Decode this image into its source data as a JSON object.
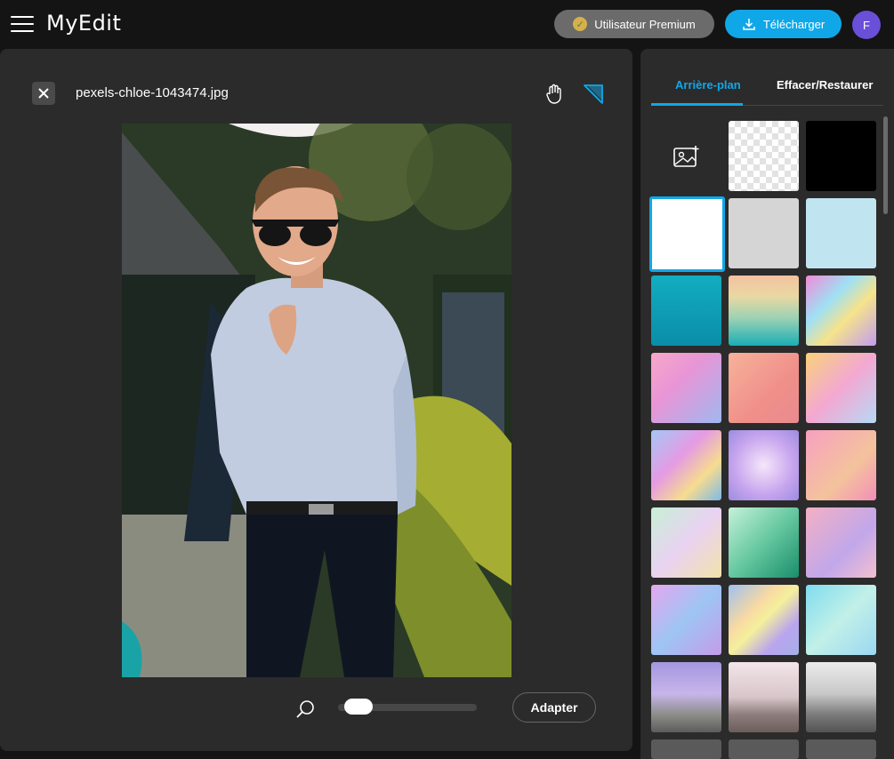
{
  "header": {
    "logo": "MyEdit",
    "premium_label": "Utilisateur Premium",
    "download_label": "Télécharger",
    "avatar_letter": "F"
  },
  "canvas": {
    "filename": "pexels-chloe-1043474.jpg",
    "fit_label": "Adapter",
    "zoom": 0.06
  },
  "sidebar": {
    "tabs": [
      "Arrière-plan",
      "Effacer/Restaurer"
    ],
    "active_tab": 0
  },
  "colors": {
    "accent": "#10a7e8",
    "avatar": "#6a4fd8",
    "panel": "#2b2b2b",
    "bg": "#141414"
  },
  "icons": [
    "menu-icon",
    "premium-badge-icon",
    "download-icon",
    "close-icon",
    "hand-icon",
    "eraser-icon",
    "zoom-icon",
    "image-upload-icon"
  ]
}
